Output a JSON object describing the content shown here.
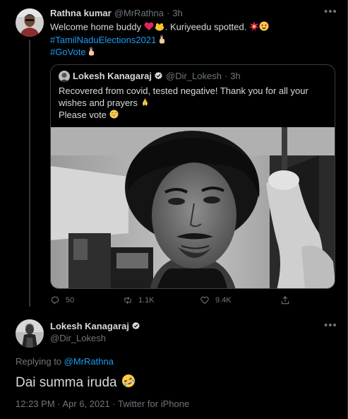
{
  "colors": {
    "background": "#000000",
    "text": "#d9d9d9",
    "muted": "#6e767d",
    "link": "#1d9bf0",
    "verified": "#d9d9d9"
  },
  "retweet_tweet": {
    "author_name": "Rathna kumar",
    "author_handle": "@MrRathna",
    "separator": "·",
    "time": "3h",
    "line1": "Welcome home buddy",
    "line1_mid": ". Kuriyeedu spotted.",
    "emojis": [
      "red-heart",
      "hug-hands",
      "explosion",
      "star-struck",
      "inked-finger"
    ],
    "hashtag1": "#TamilNaduElections2021",
    "hashtag2": "#GoVote"
  },
  "quoted_tweet": {
    "author_name": "Lokesh Kanagaraj",
    "author_handle": "@Dir_Lokesh",
    "separator": "·",
    "time": "3h",
    "line1": "Recovered from covid, tested negative! Thank you for all your",
    "line2": "wishes and prayers",
    "line3": "Please vote",
    "emojis": [
      "folded-hands",
      "grinning-face"
    ],
    "photo": "black-and-white selfie photo"
  },
  "actions": {
    "replies": "50",
    "retweets": "1.1K",
    "likes": "9.4K"
  },
  "main_tweet": {
    "author_name": "Lokesh Kanagaraj",
    "author_handle": "@Dir_Lokesh",
    "replying_prefix": "Replying to",
    "replying_to": "@MrRathna",
    "text": "Dai summa iruda",
    "emoji": "rolling-on-floor-laughing",
    "timestamp": "12:23 PM · Apr 6, 2021 · Twitter for iPhone"
  }
}
